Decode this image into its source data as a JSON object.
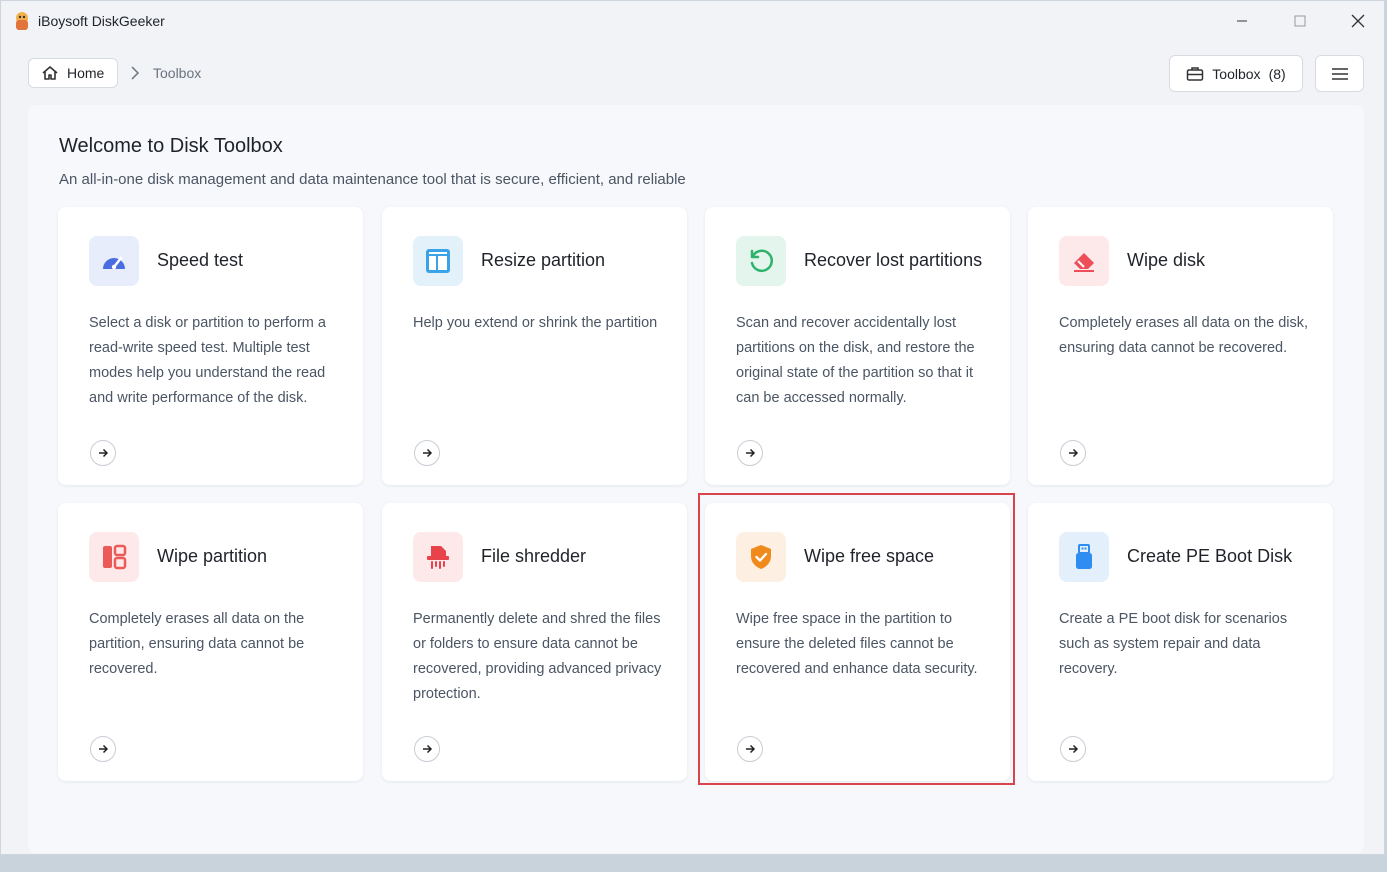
{
  "window": {
    "title": "iBoysoft DiskGeeker"
  },
  "nav": {
    "home_label": "Home",
    "current": "Toolbox",
    "toolbox_button": "Toolbox",
    "toolbox_count": "(8)"
  },
  "main": {
    "title": "Welcome to Disk Toolbox",
    "subtitle": "An all-in-one disk management and data maintenance tool that is secure, efficient, and reliable"
  },
  "cards": [
    {
      "title": "Speed test",
      "desc": "Select a disk or partition to perform a read-write speed test. Multiple test modes help you understand the read and write performance of the disk.",
      "icon": "speedometer-icon",
      "icon_bg": "#e8edfb",
      "icon_color": "#4a6ee0"
    },
    {
      "title": "Resize partition",
      "desc": "Help you extend or shrink the partition",
      "icon": "layout-icon",
      "icon_bg": "#e3f1fb",
      "icon_color": "#3aa3e8"
    },
    {
      "title": "Recover lost partitions",
      "desc": "Scan and recover accidentally lost partitions on the disk, and restore the original state of the partition so that it can be accessed normally.",
      "icon": "restore-icon",
      "icon_bg": "#e3f5ec",
      "icon_color": "#2fb36b"
    },
    {
      "title": "Wipe disk",
      "desc": "Completely erases all data on the disk, ensuring data cannot be recovered.",
      "icon": "eraser-icon",
      "icon_bg": "#fde9ea",
      "icon_color": "#ec4f57"
    },
    {
      "title": "Wipe partition",
      "desc": "Completely erases all data on the partition, ensuring data cannot be recovered.",
      "icon": "partition-icon",
      "icon_bg": "#fde9ea",
      "icon_color": "#ec5a58"
    },
    {
      "title": "File shredder",
      "desc": "Permanently delete and shred the files or folders to ensure data cannot be recovered, providing advanced privacy protection.",
      "icon": "shredder-icon",
      "icon_bg": "#fde9ea",
      "icon_color": "#e8424a"
    },
    {
      "title": "Wipe free space",
      "desc": "Wipe free space in the partition to ensure the deleted files cannot be recovered and enhance data security.",
      "icon": "shield-icon",
      "icon_bg": "#fdf0e2",
      "icon_color": "#f08a1c"
    },
    {
      "title": "Create PE Boot Disk",
      "desc": "Create a PE boot disk for scenarios such as system repair and data recovery.",
      "icon": "usb-drive-icon",
      "icon_bg": "#e3f0fc",
      "icon_color": "#2f8cf0"
    }
  ]
}
